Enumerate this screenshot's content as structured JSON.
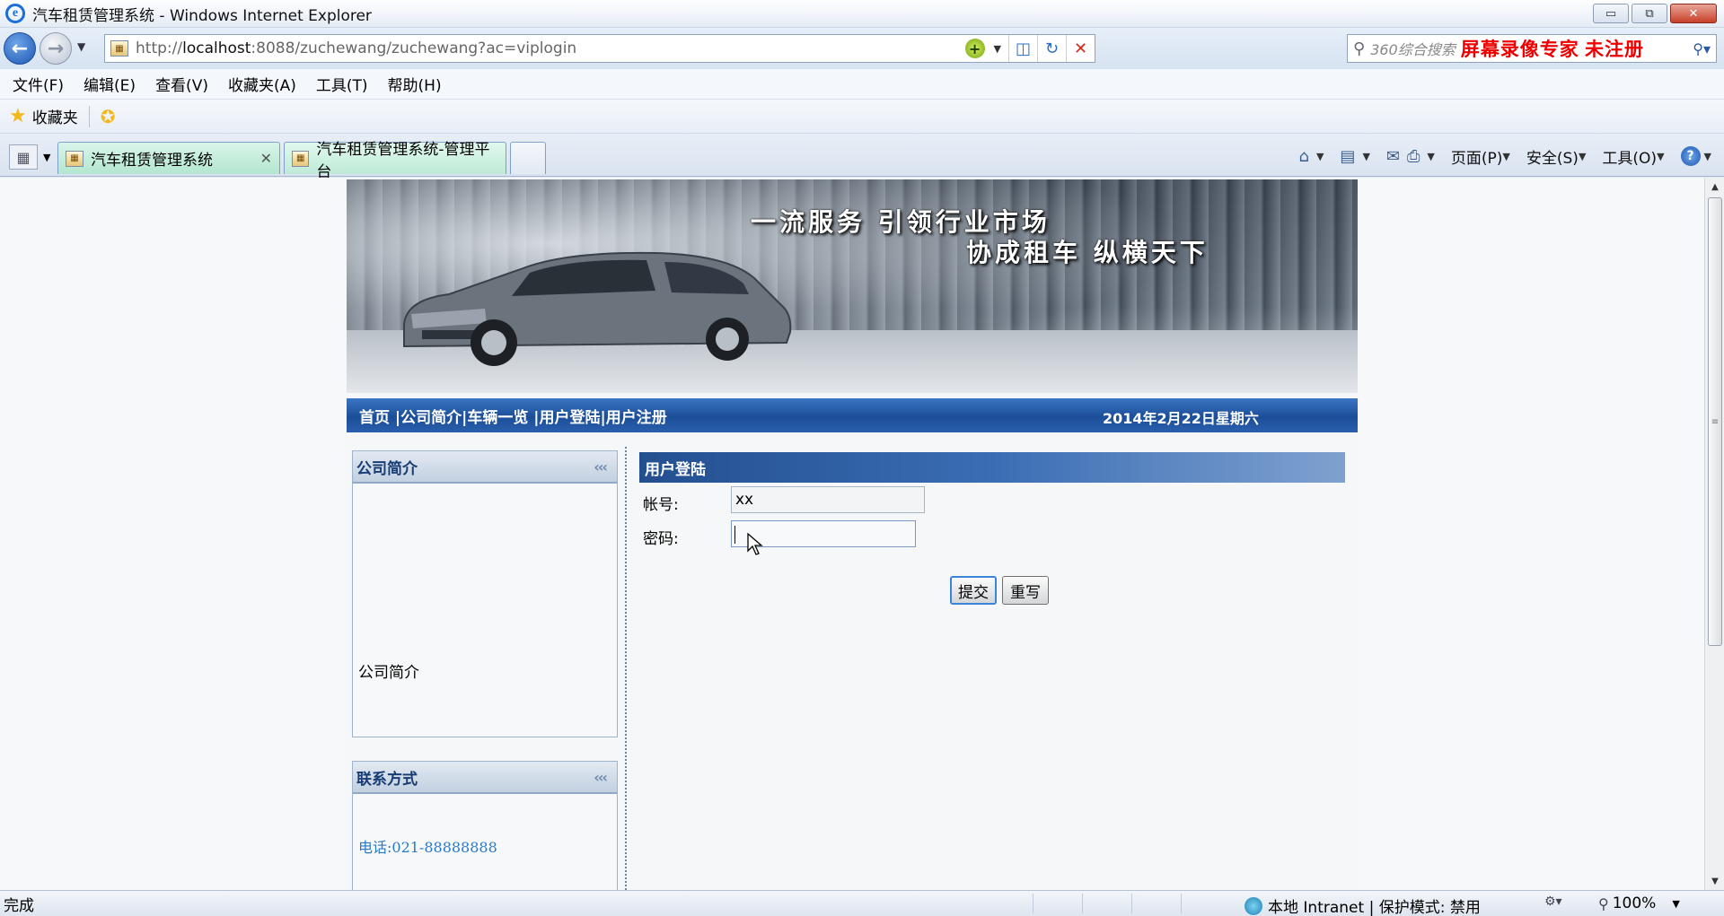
{
  "window": {
    "title": "汽车租赁管理系统 - Windows Internet Explorer",
    "controls": [
      "▭",
      "⧉",
      "✕"
    ]
  },
  "address_bar": {
    "url_prefix": "http://",
    "url_host": "localhost",
    "url_rest": ":8088/zuchewang/zuchewang?ac=viplogin"
  },
  "search_bar": {
    "placeholder": "360综合搜索",
    "watermark": "屏幕录像专家  未注册"
  },
  "menu": [
    "文件(F)",
    "编辑(E)",
    "查看(V)",
    "收藏夹(A)",
    "工具(T)",
    "帮助(H)"
  ],
  "favorites_bar": {
    "label": "收藏夹"
  },
  "tabs": [
    {
      "label": "汽车租赁管理系统",
      "active": true
    },
    {
      "label": "汽车租赁管理系统-管理平台",
      "active": false
    }
  ],
  "command_bar": {
    "page": "页面(P)",
    "safety": "安全(S)",
    "tools": "工具(O)"
  },
  "banner": {
    "slogan1": "一流服务  引领行业市场",
    "slogan2": "协成租车  纵横天下"
  },
  "site_nav": {
    "links": [
      "首页 ",
      "|公司简介",
      "|车辆一览",
      " |用户登陆",
      "|用户注册"
    ],
    "date": "2014年2月22日星期六"
  },
  "sidebar": {
    "company": {
      "title": "公司简介",
      "arrows": "‹‹‹",
      "body": "公司简介"
    },
    "contact": {
      "title": "联系方式",
      "arrows": "‹‹‹",
      "phone": "电话:021-88888888"
    }
  },
  "login": {
    "title": "用户登陆",
    "account_label": "帐号:",
    "account_value": "xx",
    "password_label": "密码:",
    "password_value": "",
    "submit_label": "提交",
    "reset_label": "重写"
  },
  "status_bar": {
    "status": "完成",
    "zone": "本地 Intranet | 保护模式: 禁用",
    "zoom": "100%"
  },
  "colors": {
    "nav_bar": "#1c4e98",
    "login_header": "#234f8f",
    "phone_text": "#2a79c9",
    "box_header_text": "#173c73"
  }
}
